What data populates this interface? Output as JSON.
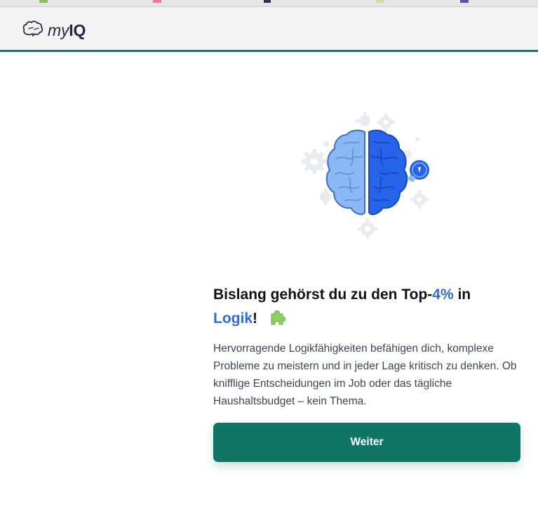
{
  "header": {
    "logo_my": "my",
    "logo_iq": "IQ"
  },
  "result": {
    "headline_pre": "Bislang gehörst du zu den Top-",
    "headline_percent": "4%",
    "headline_mid": " in",
    "headline_category": "Logik",
    "headline_post": "!",
    "description": "Hervorragende Logikfähigkeiten befähigen dich, komplexe Probleme zu meistern und in jeder Lage kritisch zu denken. Ob knifflige Entscheidungen im Job oder das tägliche Haushaltsbudget – kein Thema."
  },
  "cta": {
    "label": "Weiter"
  },
  "colors": {
    "brand": "#117566",
    "accent": "#2f6ae0",
    "brain_left": "#8ab8f5",
    "brain_right": "#2563eb"
  },
  "icons": {
    "logo": "brain-icon",
    "illustration": "brain-illustration",
    "emoji": "puzzle-icon"
  }
}
